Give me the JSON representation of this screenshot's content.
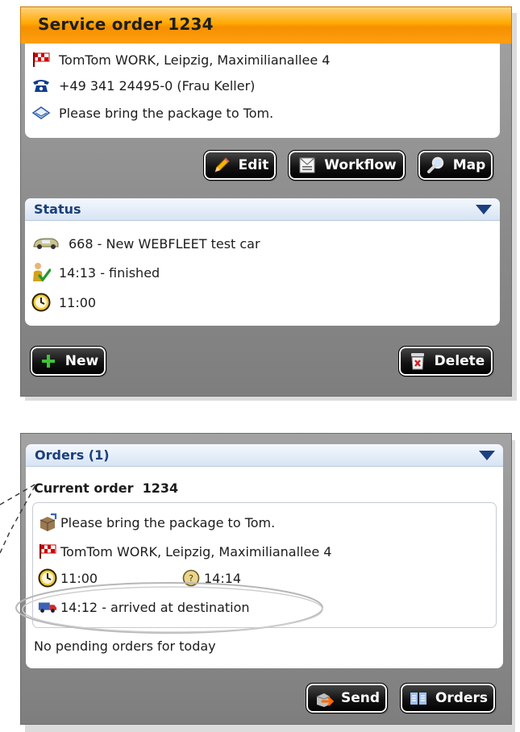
{
  "service_order": {
    "title": "Service order 1234",
    "address": "TomTom WORK,  Leipzig, Maximilianallee 4",
    "phone": "+49 341 24495-0 (Frau Keller)",
    "note": "Please bring the package to Tom.",
    "buttons": {
      "edit": "Edit",
      "workflow": "Workflow",
      "map": "Map"
    }
  },
  "status": {
    "header": "Status",
    "vehicle": "668 - New WEBFLEET test car",
    "state": "14:13 - finished",
    "time": "11:00",
    "buttons": {
      "new": "New",
      "delete": "Delete"
    }
  },
  "orders": {
    "header": "Orders (1)",
    "current_label": "Current order  1234",
    "note": "Please bring the package to Tom.",
    "address": "TomTom WORK, Leipzig, Maximilianallee 4",
    "planned_time": "11:00",
    "eta_time": "14:14",
    "arrival": "14:12 - arrived at destination",
    "pending": "No pending orders for today",
    "buttons": {
      "send": "Send",
      "orders": "Orders"
    }
  },
  "colors": {
    "header_orange": "#ffa800",
    "section_blue_text": "#1b3f7a",
    "panel_gray": "#8a8a8a",
    "button_black": "#121212"
  },
  "icons": {
    "address": "flag-icon",
    "phone": "phone-icon",
    "note": "envelope-icon",
    "vehicle": "car-icon",
    "state": "person-check-icon",
    "time": "clock-icon",
    "package": "package-icon",
    "eta": "clock-eta-icon",
    "arrival": "truck-icon",
    "edit": "pencil-icon",
    "workflow": "mail-icon",
    "map": "magnifier-icon",
    "new": "plus-icon",
    "delete": "trash-icon",
    "send": "send-icon",
    "orders": "book-icon"
  }
}
